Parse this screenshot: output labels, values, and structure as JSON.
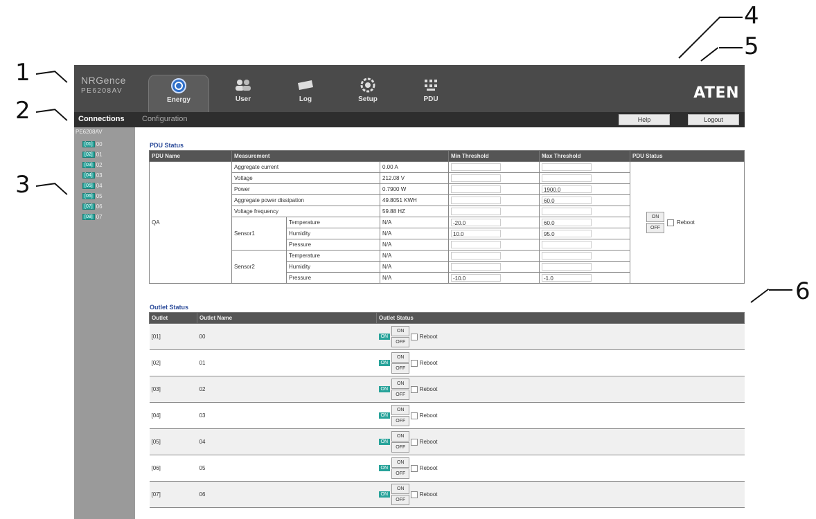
{
  "callouts": [
    "1",
    "2",
    "3",
    "4",
    "5",
    "6"
  ],
  "header": {
    "brand_name": "NRGence",
    "brand_model": "PE6208AV",
    "logo": "ATEN",
    "tabs": [
      {
        "label": "Energy",
        "icon": "energy-icon",
        "active": true
      },
      {
        "label": "User",
        "icon": "user-icon",
        "active": false
      },
      {
        "label": "Log",
        "icon": "log-icon",
        "active": false
      },
      {
        "label": "Setup",
        "icon": "setup-icon",
        "active": false
      },
      {
        "label": "PDU",
        "icon": "pdu-icon",
        "active": false
      }
    ]
  },
  "menu": {
    "connections": "Connections",
    "configuration": "Configuration",
    "help": "Help",
    "logout": "Logout"
  },
  "sidebar": {
    "root": "PE6208AV",
    "outlets": [
      {
        "tag": "[01]",
        "name": "00"
      },
      {
        "tag": "[02]",
        "name": "01"
      },
      {
        "tag": "[03]",
        "name": "02"
      },
      {
        "tag": "[04]",
        "name": "03"
      },
      {
        "tag": "[05]",
        "name": "04"
      },
      {
        "tag": "[06]",
        "name": "05"
      },
      {
        "tag": "[07]",
        "name": "06"
      },
      {
        "tag": "[08]",
        "name": "07"
      }
    ]
  },
  "pdu_status": {
    "title": "PDU Status",
    "headers": [
      "PDU Name",
      "Measurement",
      "Min Threshold",
      "Max Threshold",
      "PDU Status"
    ],
    "pdu_name": "QA",
    "rows": [
      {
        "label": "Aggregate current",
        "value": "0.00 A",
        "min": "",
        "max": ""
      },
      {
        "label": "Voltage",
        "value": "212.08 V",
        "min": "",
        "max": ""
      },
      {
        "label": "Power",
        "value": "0.7900 W",
        "min": "",
        "max": "1900.0"
      },
      {
        "label": "Aggregate power dissipation",
        "value": "49.8051 KWH",
        "min": "",
        "max": "60.0"
      },
      {
        "label": "Voltage frequency",
        "value": "59.88 HZ",
        "min": "",
        "max": ""
      }
    ],
    "sensors": [
      {
        "name": "Sensor1",
        "rows": [
          {
            "label": "Temperature",
            "value": "N/A",
            "min": "-20.0",
            "max": "60.0"
          },
          {
            "label": "Humidity",
            "value": "N/A",
            "min": "10.0",
            "max": "95.0"
          },
          {
            "label": "Pressure",
            "value": "N/A",
            "min": "",
            "max": ""
          }
        ]
      },
      {
        "name": "Sensor2",
        "rows": [
          {
            "label": "Temperature",
            "value": "N/A",
            "min": "",
            "max": ""
          },
          {
            "label": "Humidity",
            "value": "N/A",
            "min": "",
            "max": ""
          },
          {
            "label": "Pressure",
            "value": "N/A",
            "min": "-10.0",
            "max": "-1.0"
          }
        ]
      }
    ],
    "on_label": "ON",
    "off_label": "OFF",
    "reboot_label": "Reboot"
  },
  "outlet_status": {
    "title": "Outlet Status",
    "headers": [
      "Outlet",
      "Outlet Name",
      "Outlet Status"
    ],
    "state_label": "ON",
    "on_label": "ON",
    "off_label": "OFF",
    "reboot_label": "Reboot",
    "rows": [
      {
        "outlet": "[01]",
        "name": "00"
      },
      {
        "outlet": "[02]",
        "name": "01"
      },
      {
        "outlet": "[03]",
        "name": "02"
      },
      {
        "outlet": "[04]",
        "name": "03"
      },
      {
        "outlet": "[05]",
        "name": "04"
      },
      {
        "outlet": "[06]",
        "name": "05"
      },
      {
        "outlet": "[07]",
        "name": "06"
      }
    ]
  },
  "colors": {
    "accent": "#28a39a",
    "header": "#4a4a4a",
    "sidebar": "#9a9a9a",
    "title": "#2a4a99"
  }
}
